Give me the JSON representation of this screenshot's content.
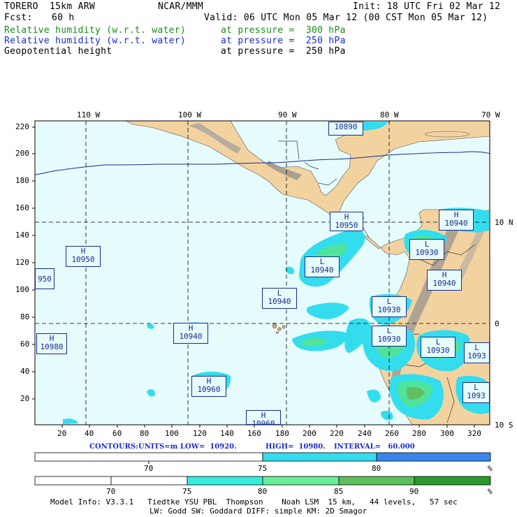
{
  "header": {
    "model": "TORERO  15km ARW",
    "org": "NCAR/MMM",
    "init": "Init: 18 UTC Fri 02 Mar 12",
    "fcst_label": "Fcst:",
    "fcst_value": "60 h",
    "valid": "Valid: 06 UTC Mon 05 Mar 12 (00 CST Mon 05 Mar 12)",
    "fields": [
      {
        "name": "Relative humidity (w.r.t. water)",
        "level": "at pressure =  300 hPa",
        "color": "#1a8c1a"
      },
      {
        "name": "Relative humidity (w.r.t. water)",
        "level": "at pressure =  250 hPa",
        "color": "#1a2ccc"
      },
      {
        "name": "Geopotential height",
        "level": "at pressure =  250 hPa",
        "color": "#000000"
      }
    ]
  },
  "map": {
    "top_lon_labels": [
      "110 W",
      "100 W",
      "90 W",
      "80 W",
      "70 W"
    ],
    "right_lat_labels": [
      "10 N",
      "0",
      "10 S"
    ],
    "y_ticks": [
      "220",
      "200",
      "180",
      "160",
      "140",
      "120",
      "100",
      "80",
      "60",
      "40",
      "20"
    ],
    "x_ticks": [
      "20",
      "40",
      "60",
      "80",
      "100",
      "120",
      "140",
      "160",
      "180",
      "200",
      "220",
      "240",
      "260",
      "280",
      "300",
      "320"
    ],
    "colors": {
      "ocean": "#e6fbfb",
      "land": "#f2d3a0",
      "mountain": "#9a9a9a",
      "rh70": "#33ddee",
      "rh75": "#1bcfcf",
      "rh80": "#4fe39b",
      "rh85": "#60c060",
      "rh90": "#2a9a2a",
      "contour": "#1a2a8c"
    },
    "centers": [
      {
        "type": "H",
        "value": "10890"
      },
      {
        "type": "H",
        "value": "10950"
      },
      {
        "type": "H",
        "value": "10940"
      },
      {
        "type": "H",
        "value": "10950"
      },
      {
        "type": "L",
        "value": "10940"
      },
      {
        "type": "L",
        "value": "10930"
      },
      {
        "type": "H",
        "value": "10940"
      },
      {
        "type": "L",
        "value": "10940"
      },
      {
        "type": "L",
        "value": "10930"
      },
      {
        "type": "H",
        "value": "10980"
      },
      {
        "type": "H",
        "value": "10940"
      },
      {
        "type": "L",
        "value": "10930"
      },
      {
        "type": "L",
        "value": "10930"
      },
      {
        "type": "L",
        "value": "1093"
      },
      {
        "type": "H",
        "value": "10960"
      },
      {
        "type": "L",
        "value": "1093"
      },
      {
        "type": "H",
        "value": "10960"
      },
      {
        "type": "",
        "value": "950"
      }
    ]
  },
  "contours": {
    "label": "CONTOURS:",
    "units": "UNITS=m",
    "low": "LOW=  10920.",
    "high": "HIGH=  10980.",
    "interval": "INTERVAL=   60.000"
  },
  "colorbar1": {
    "ticks": [
      "70",
      "75",
      "80"
    ],
    "unit": "%",
    "colors": [
      "#ffffff",
      "#33ddee",
      "#3a86ee"
    ]
  },
  "colorbar2": {
    "ticks": [
      "70",
      "75",
      "80",
      "85",
      "90"
    ],
    "unit": "%",
    "colors": [
      "#ffffff",
      "#ffffff",
      "#33ddee",
      "#66ee99",
      "#5cc05c",
      "#2a9a2a"
    ]
  },
  "footer": {
    "line1": "Model Info: V3.3.1   Tiedtke YSU PBL  Thompson    Noah LSM  15 km,   44 levels,   57 sec",
    "line2": "LW: Godd SW: Goddard DIFF: simple KM: 2D Smagor"
  }
}
